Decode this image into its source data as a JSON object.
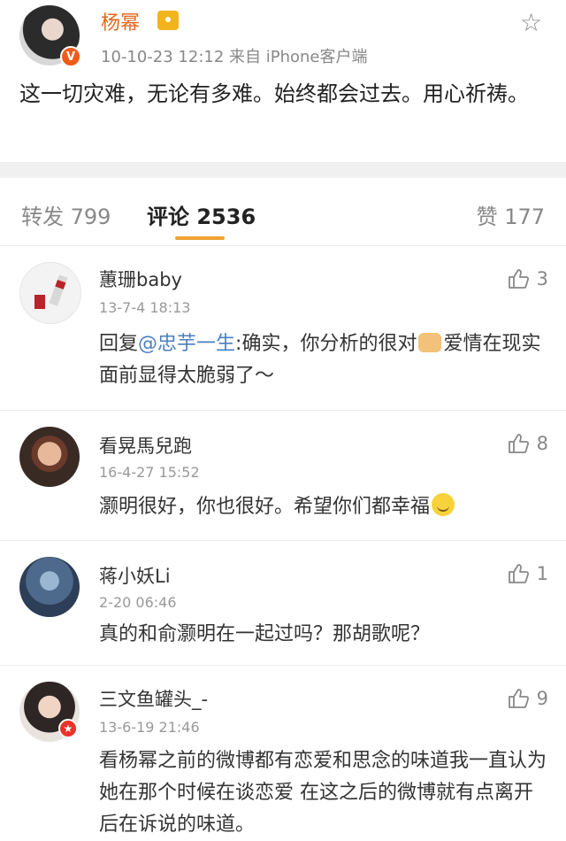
{
  "post": {
    "author": "杨幂",
    "meta": "10-10-23 12:12  来自 iPhone客户端",
    "body": "这一切灾难，无论有多难。始终都会过去。用心祈祷。"
  },
  "tabs": {
    "repost": "转发 799",
    "comments": "评论 2536",
    "likes": "赞 177"
  },
  "comments": [
    {
      "name": "蕙珊baby",
      "time": "13-7-4 18:13",
      "prefix": "回复",
      "mention": "@忠芋一生",
      "text_a": ":确实，你分析的很对",
      "text_b": "爱情在现实面前显得太脆弱了～",
      "likes": "3"
    },
    {
      "name": "看晃馬兒跑",
      "time": "16-4-27 15:52",
      "text": "灏明很好，你也很好。希望你们都幸福",
      "likes": "8"
    },
    {
      "name": "蒋小妖Li",
      "time": "2-20 06:46",
      "text": "真的和俞灏明在一起过吗？那胡歌呢？",
      "likes": "1"
    },
    {
      "name": "三文鱼罐头_-",
      "time": "13-6-19 21:46",
      "text": "看杨幂之前的微博都有恋爱和思念的味道我一直认为她在那个时候在谈恋爱 在这之后的微博就有点离开后在诉说的味道。",
      "likes": "9"
    }
  ],
  "colors": {
    "author": "#e8661a",
    "mention": "#4a7fc1",
    "tab_underline": "#f0a232",
    "verified_badge": "#f25a1a"
  },
  "icons": [
    "star-icon",
    "thumb-up-icon",
    "verified-icon",
    "crown-icon",
    "thumbs-up-emoji-icon",
    "smile-emoji-icon"
  ]
}
